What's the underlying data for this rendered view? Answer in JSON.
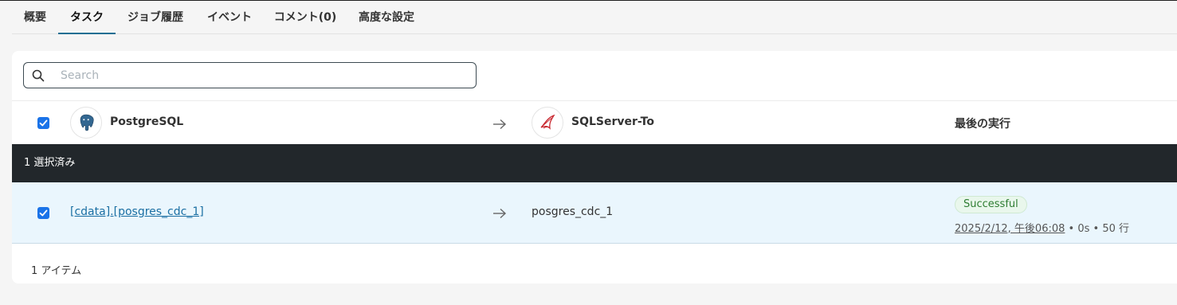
{
  "tabs": [
    {
      "label": "概要"
    },
    {
      "label": "タスク"
    },
    {
      "label": "ジョブ履歴"
    },
    {
      "label": "イベント"
    },
    {
      "label": "コメント(0)"
    },
    {
      "label": "高度な設定"
    }
  ],
  "active_tab": "タスク",
  "search": {
    "placeholder": "Search",
    "value": ""
  },
  "header": {
    "source_name": "PostgreSQL",
    "target_name": "SQLServer-To",
    "last_run_label": "最後の実行"
  },
  "selection": {
    "text": "1 選択済み"
  },
  "row": {
    "source_task": "[cdata].[posgres_cdc_1]",
    "target_task": "posgres_cdc_1",
    "status": "Successful",
    "last_run_time": "2025/2/12, 午後06:08",
    "duration": "0s",
    "rows": "50 行"
  },
  "footer": {
    "count_text": "1 アイテム"
  },
  "colors": {
    "accent": "#1e6f93",
    "checkbox": "#1a73e8",
    "selection_bar": "#22272b",
    "row_highlight": "#eaf6fd",
    "success": "#2e7d32"
  },
  "icons": [
    "search-icon",
    "postgresql-logo",
    "sqlserver-logo",
    "arrow-right-icon",
    "checkbox-checked-icon"
  ]
}
